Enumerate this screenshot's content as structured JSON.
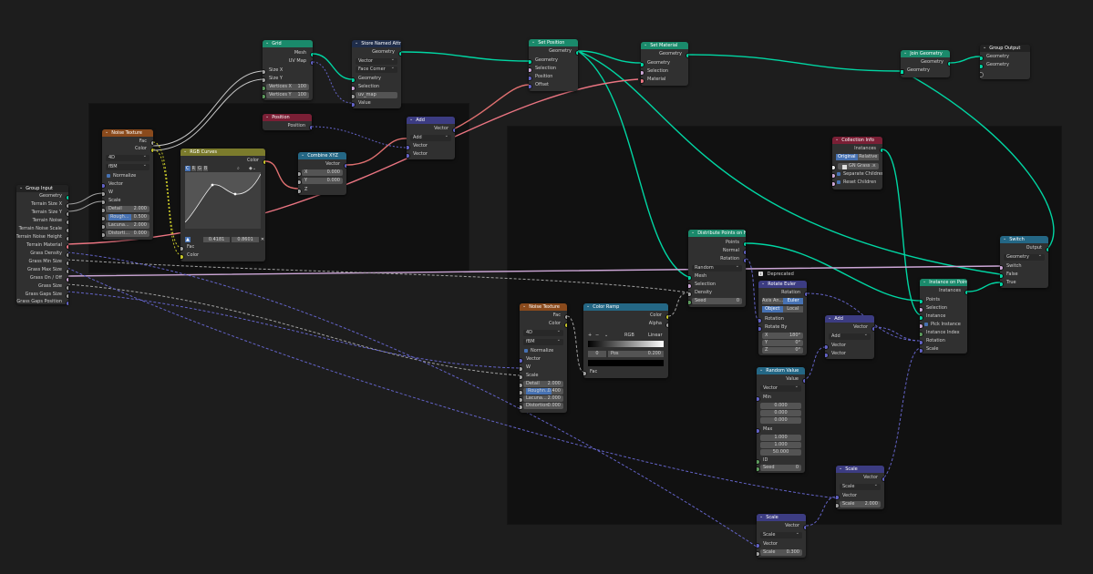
{
  "colors": {
    "geometry": "#00d6a3",
    "vector": "#6363c7",
    "float": "#a1a1a1",
    "color": "#c7c729",
    "boolean": "#cca6d6",
    "integer": "#5d9b5d",
    "material": "#eb7582"
  },
  "nodes": {
    "group_input": {
      "title": "Group Input",
      "outputs": [
        "Geometry",
        "Terrain Size X",
        "Terrain Size Y",
        "Terrain Noise",
        "Terrain Noise Scale",
        "Terrain Noise Height",
        "Terrain Material",
        "Grass Density",
        "Grass Min Size",
        "Grass Max Size",
        "Grass On / Off",
        "Grass Size",
        "Grass Gaps Size",
        "Grass Gaps Position"
      ]
    },
    "noise1": {
      "title": "Noise Texture",
      "outputs": [
        "Fac",
        "Color"
      ],
      "dim": "4D",
      "type": "fBM",
      "normalize": "Normalize",
      "inputs": [
        "Vector",
        "W",
        "Scale"
      ],
      "detail": {
        "label": "Detail",
        "value": "2.000"
      },
      "roughness": {
        "label": "Rough...",
        "value": "0.500"
      },
      "lacunarity": {
        "label": "Lacuna...",
        "value": "2.000"
      },
      "distortion": {
        "label": "Distorti...",
        "value": "0.000"
      }
    },
    "grid": {
      "title": "Grid",
      "outputs": [
        "Mesh",
        "UV Map"
      ],
      "inputs": [
        "Size X",
        "Size Y"
      ],
      "vx": {
        "label": "Vertices X",
        "value": "100"
      },
      "vy": {
        "label": "Vertices Y",
        "value": "100"
      }
    },
    "store": {
      "title": "Store Named Attri...",
      "output": "Geometry",
      "type": "Vector",
      "domain": "Face Corner",
      "inputs": [
        "Geometry",
        "Selection"
      ],
      "name": "uv_map",
      "value": "Value"
    },
    "position": {
      "title": "Position",
      "output": "Position"
    },
    "add1": {
      "title": "Add",
      "output": "Vector",
      "op": "Add",
      "inputs": [
        "Vector",
        "Vector"
      ]
    },
    "rgb": {
      "title": "RGB Curves",
      "output": "Color",
      "channels": [
        "C",
        "R",
        "G",
        "B"
      ],
      "x": "0.4181",
      "y": "0.8601",
      "inputs": [
        "Fac",
        "Color"
      ]
    },
    "combine": {
      "title": "Combine XYZ",
      "output": "Vector",
      "x": {
        "label": "X",
        "value": "0.000"
      },
      "y": {
        "label": "Y",
        "value": "0.000"
      },
      "z": "Z"
    },
    "setpos": {
      "title": "Set Position",
      "output": "Geometry",
      "inputs": [
        "Geometry",
        "Selection",
        "Position",
        "Offset"
      ]
    },
    "setmat": {
      "title": "Set Material",
      "output": "Geometry",
      "inputs": [
        "Geometry",
        "Selection",
        "Material"
      ]
    },
    "join": {
      "title": "Join Geometry",
      "output": "Geometry",
      "input": "Geometry"
    },
    "gout": {
      "title": "Group Output",
      "inputs": [
        "Geometry",
        "Geometry"
      ]
    },
    "coll": {
      "title": "Collection Info",
      "output": "Instances",
      "modes": [
        "Original",
        "Relative"
      ],
      "collection": "GN Grass ...",
      "sep": "Separate Children",
      "reset": "Reset Children"
    },
    "dist": {
      "title": "Distribute Points on Fac...",
      "outputs": [
        "Points",
        "Normal",
        "Rotation"
      ],
      "mode": "Random",
      "inputs": [
        "Mesh",
        "Selection",
        "Density"
      ],
      "seed": {
        "label": "Seed",
        "value": "0"
      }
    },
    "deprecated": "Deprecated",
    "rot": {
      "title": "Rotate Euler",
      "output": "Rotation",
      "axis": "Axis An...",
      "euler": "Euler",
      "obj": "Object",
      "local": "Local",
      "inputs": [
        "Rotation",
        "Rotate By"
      ],
      "x": {
        "label": "X",
        "value": "180°"
      },
      "y": {
        "label": "Y",
        "value": "0°"
      },
      "z": {
        "label": "Z",
        "value": "0°"
      }
    },
    "switch": {
      "title": "Switch",
      "output": "Output",
      "type": "Geometry",
      "inputs": [
        "Switch",
        "False",
        "True"
      ]
    },
    "iop": {
      "title": "Instance on Points",
      "output": "Instances",
      "inputs": [
        "Points",
        "Selection",
        "Instance"
      ],
      "pick": "Pick Instance",
      "inputs2": [
        "Instance Index",
        "Rotation",
        "Scale"
      ]
    },
    "noise2": {
      "title": "Noise Texture",
      "outputs": [
        "Fac",
        "Color"
      ],
      "dim": "4D",
      "type": "fBM",
      "normalize": "Normalize",
      "inputs": [
        "Vector",
        "W",
        "Scale"
      ],
      "detail": {
        "label": "Detail",
        "value": "2.000"
      },
      "roughness": {
        "label": "Roughn...",
        "value": "0.400"
      },
      "lacunarity": {
        "label": "Lacuna...",
        "value": "2.000"
      },
      "distortion": {
        "label": "Distortion",
        "value": "0.000"
      }
    },
    "ramp": {
      "title": "Color Ramp",
      "outputs": [
        "Color",
        "Alpha"
      ],
      "mode": "RGB",
      "interp": "Linear",
      "index": "0",
      "pos": {
        "label": "Pos",
        "value": "0.200"
      },
      "input": "Fac"
    },
    "add2": {
      "title": "Add",
      "output": "Vector",
      "op": "Add",
      "inputs": [
        "Vector",
        "Vector"
      ]
    },
    "rand": {
      "title": "Random Value",
      "output": "Value",
      "type": "Vector",
      "min": "Min",
      "minv": [
        "0.000",
        "0.000",
        "0.000"
      ],
      "max": "Max",
      "maxv": [
        "1.000",
        "1.000",
        "50.000"
      ],
      "id": "ID",
      "seed": {
        "label": "Seed",
        "value": "0"
      }
    },
    "scale1": {
      "title": "Scale",
      "output": "Vector",
      "op": "Scale",
      "input": "Vector",
      "scale": {
        "label": "Scale",
        "value": "2.000"
      }
    },
    "scale2": {
      "title": "Scale",
      "output": "Vector",
      "op": "Scale",
      "input": "Vector",
      "scale": {
        "label": "Scale",
        "value": "0.300"
      }
    }
  }
}
